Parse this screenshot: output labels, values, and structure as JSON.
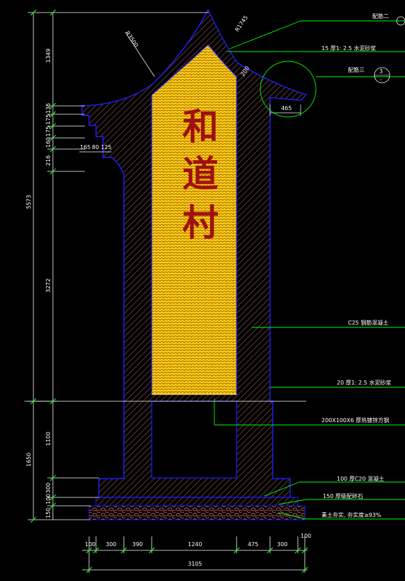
{
  "colors": {
    "background": "#000000",
    "outline": "#2020ff",
    "hatch": "#8a5050",
    "panel_fill": "#ffd21a",
    "panel_pattern": "#c89000",
    "dimension": "#ffffff",
    "leader": "#00ff00",
    "characters": "#a01010"
  },
  "vertical_dims_outer": [
    "5573",
    "1650",
    "150"
  ],
  "vertical_dims_left": [
    "1349",
    "135",
    "175",
    "175",
    "160",
    "216",
    "3272",
    "1100",
    "300",
    "100"
  ],
  "horizontal_dims": [
    "100",
    "300",
    "390",
    "1240",
    "475",
    "300",
    "100"
  ],
  "total_width": "3105",
  "radius_main": "R3500",
  "radius_top": "R1745",
  "roof_detail": [
    "165",
    "80",
    "125"
  ],
  "eave_dim": "465",
  "roof_slope_dim": "200",
  "panel_characters": [
    "和",
    "道",
    "村"
  ],
  "callouts": {
    "ref_top": "配筋二",
    "ref_circle": "配筋三",
    "ref_circle_num": "3",
    "ref_circle_sub": "-",
    "cap_mortar": "15 厚1: 2.5 水泥砂浆",
    "concrete": "C25 钢筋混凝土",
    "plaster": "20 厚1: 2.5 水泥砂浆",
    "steel_tube": "200X100X6 厚热镀锌方钢",
    "base_concrete": "100 厚C20 混凝土",
    "gravel": "150 厚级配碎石",
    "soil": "素土夯实, 夯实度≥93%"
  }
}
